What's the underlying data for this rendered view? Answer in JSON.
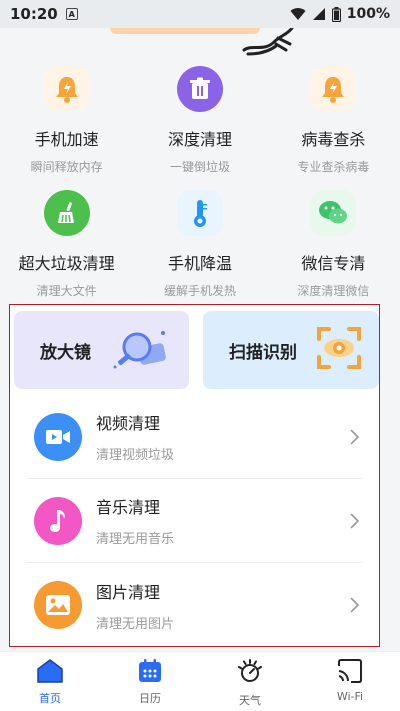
{
  "status": {
    "time": "10:20",
    "battery": "100%",
    "badge": "A"
  },
  "grid": [
    {
      "title": "手机加速",
      "sub": "瞬间释放内存",
      "icon": "bell-icon",
      "bg": "#fff4e6",
      "color": "#f7a53a"
    },
    {
      "title": "深度清理",
      "sub": "一键倒垃圾",
      "icon": "trash-icon",
      "bg": "#8b63e6",
      "color": "#ffffff"
    },
    {
      "title": "病毒查杀",
      "sub": "专业查杀病毒",
      "icon": "bell-icon",
      "bg": "#fff4e6",
      "color": "#f7a53a"
    },
    {
      "title": "超大垃圾清理",
      "sub": "清理大文件",
      "icon": "broom-icon",
      "bg": "#4cbf4c",
      "color": "#ffffff"
    },
    {
      "title": "手机降温",
      "sub": "缓解手机发热",
      "icon": "thermometer-icon",
      "bg": "#e8f4ff",
      "color": "#2196f3"
    },
    {
      "title": "微信专清",
      "sub": "深度清理微信",
      "icon": "wechat-icon",
      "bg": "#e9f8ec",
      "color": "#3cc46b"
    }
  ],
  "cards": [
    {
      "label": "放大镜",
      "icon": "magnifier-icon"
    },
    {
      "label": "扫描识别",
      "icon": "scan-eye-icon"
    }
  ],
  "list": [
    {
      "title": "视频清理",
      "sub": "清理视频垃圾",
      "icon": "video-icon",
      "color": "#3b8ff5"
    },
    {
      "title": "音乐清理",
      "sub": "清理无用音乐",
      "icon": "music-icon",
      "color": "#f257c4"
    },
    {
      "title": "图片清理",
      "sub": "清理无用图片",
      "icon": "image-icon",
      "color": "#f79a32"
    }
  ],
  "tabs": [
    {
      "label": "首页",
      "icon": "home-icon",
      "active": true
    },
    {
      "label": "日历",
      "icon": "calendar-icon",
      "active": false
    },
    {
      "label": "天气",
      "icon": "weather-icon",
      "active": false
    },
    {
      "label": "Wi-Fi",
      "icon": "cast-icon",
      "active": false
    }
  ],
  "colors": {
    "accent": "#2a6df4",
    "panel_border": "#b21e24"
  }
}
